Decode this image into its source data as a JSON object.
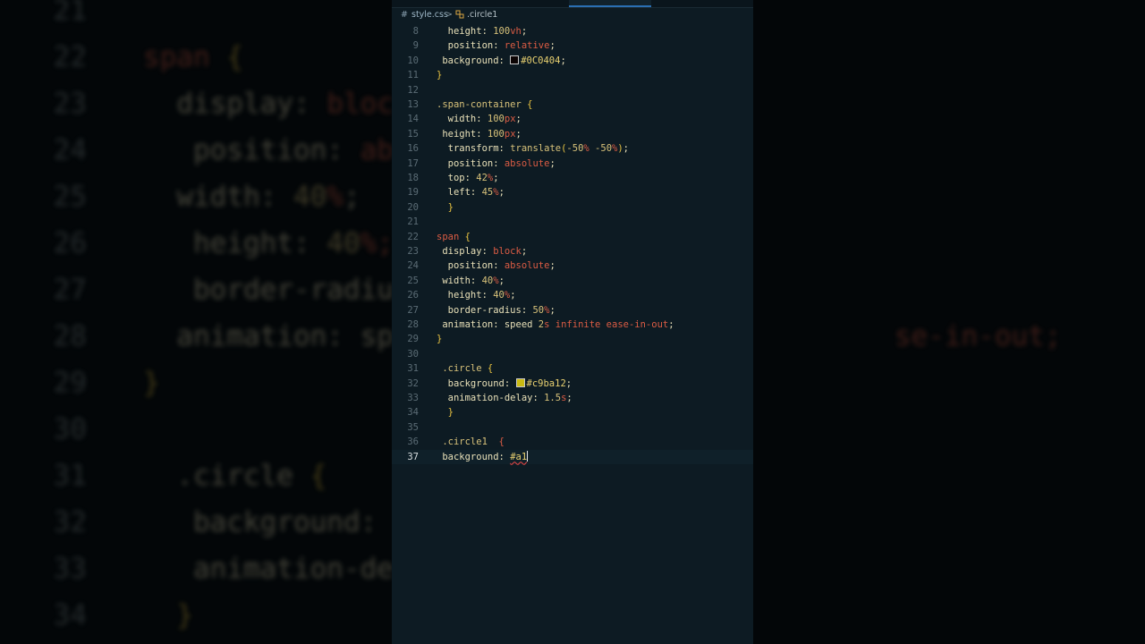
{
  "backdrop": {
    "lines": [
      {
        "num": "21",
        "segs": [
          {
            "t": "",
            "c": "w"
          }
        ]
      },
      {
        "num": "22",
        "segs": [
          {
            "t": "span",
            "c": "k"
          },
          {
            "t": " {",
            "c": "b"
          }
        ]
      },
      {
        "num": "23",
        "segs": [
          {
            "t": "  display: ",
            "c": "p"
          },
          {
            "t": "bloc",
            "c": "k"
          }
        ]
      },
      {
        "num": "24",
        "segs": [
          {
            "t": "   position: ",
            "c": "p"
          },
          {
            "t": "ab",
            "c": "k"
          }
        ]
      },
      {
        "num": "25",
        "segs": [
          {
            "t": "  width: ",
            "c": "p"
          },
          {
            "t": "40",
            "c": "n"
          },
          {
            "t": "%",
            "c": "u"
          },
          {
            "t": ";",
            "c": "p"
          }
        ]
      },
      {
        "num": "26",
        "segs": [
          {
            "t": "   height: ",
            "c": "p"
          },
          {
            "t": "40",
            "c": "n"
          },
          {
            "t": "%;",
            "c": "u"
          }
        ]
      },
      {
        "num": "27",
        "segs": [
          {
            "t": "   border-radiu",
            "c": "p"
          }
        ]
      },
      {
        "num": "28",
        "segs": [
          {
            "t": "  animation: sp",
            "c": "p"
          },
          {
            "t": "                              se-in-out;",
            "c": "k"
          }
        ]
      },
      {
        "num": "29",
        "segs": [
          {
            "t": "}",
            "c": "b"
          }
        ]
      },
      {
        "num": "30",
        "segs": [
          {
            "t": "",
            "c": "w"
          }
        ]
      },
      {
        "num": "31",
        "segs": [
          {
            "t": "  .circle ",
            "c": "p"
          },
          {
            "t": "{",
            "c": "b"
          }
        ]
      },
      {
        "num": "32",
        "segs": [
          {
            "t": "   background:",
            "c": "p"
          }
        ]
      },
      {
        "num": "33",
        "segs": [
          {
            "t": "   animation-de",
            "c": "p"
          }
        ]
      },
      {
        "num": "34",
        "segs": [
          {
            "t": "  }",
            "c": "b"
          }
        ]
      }
    ]
  },
  "breadcrumb": {
    "hash_icon": "#",
    "file": "style.css",
    "chevron": ">",
    "symbol_icon": "css-selector-icon",
    "symbol": ".circle1"
  },
  "editor": {
    "lines": [
      {
        "num": "8",
        "segs": [
          {
            "t": "  height: ",
            "c": "p"
          },
          {
            "t": "100",
            "c": "n"
          },
          {
            "t": "vh",
            "c": "u"
          },
          {
            "t": ";",
            "c": "p"
          }
        ]
      },
      {
        "num": "9",
        "segs": [
          {
            "t": "  position: ",
            "c": "p"
          },
          {
            "t": "relative",
            "c": "k"
          },
          {
            "t": ";",
            "c": "p"
          }
        ]
      },
      {
        "num": "10",
        "segs": [
          {
            "t": " background: ",
            "c": "p"
          },
          {
            "swatch": "#0C0404"
          },
          {
            "t": "#0C0404",
            "c": "s"
          },
          {
            "t": ";",
            "c": "p"
          }
        ]
      },
      {
        "num": "11",
        "segs": [
          {
            "t": "}",
            "c": "b"
          }
        ]
      },
      {
        "num": "12",
        "segs": []
      },
      {
        "num": "13",
        "segs": [
          {
            "t": ".span-container ",
            "c": "v"
          },
          {
            "t": "{",
            "c": "b"
          }
        ]
      },
      {
        "num": "14",
        "segs": [
          {
            "t": "  width: ",
            "c": "p"
          },
          {
            "t": "100",
            "c": "n"
          },
          {
            "t": "px",
            "c": "u"
          },
          {
            "t": ";",
            "c": "p"
          }
        ]
      },
      {
        "num": "15",
        "segs": [
          {
            "t": " height: ",
            "c": "p"
          },
          {
            "t": "100",
            "c": "n"
          },
          {
            "t": "px",
            "c": "u"
          },
          {
            "t": ";",
            "c": "p"
          }
        ]
      },
      {
        "num": "16",
        "segs": [
          {
            "t": "  transform: ",
            "c": "p"
          },
          {
            "t": "translate",
            "c": "v"
          },
          {
            "t": "(",
            "c": "b"
          },
          {
            "t": "-50",
            "c": "n"
          },
          {
            "t": "% ",
            "c": "u"
          },
          {
            "t": "-50",
            "c": "n"
          },
          {
            "t": "%",
            "c": "u"
          },
          {
            "t": ")",
            "c": "b"
          },
          {
            "t": ";",
            "c": "p"
          }
        ]
      },
      {
        "num": "17",
        "segs": [
          {
            "t": "  position: ",
            "c": "p"
          },
          {
            "t": "absolute",
            "c": "k"
          },
          {
            "t": ";",
            "c": "p"
          }
        ]
      },
      {
        "num": "18",
        "segs": [
          {
            "t": "  top: ",
            "c": "p"
          },
          {
            "t": "42",
            "c": "n"
          },
          {
            "t": "%",
            "c": "u"
          },
          {
            "t": ";",
            "c": "p"
          }
        ]
      },
      {
        "num": "19",
        "segs": [
          {
            "t": "  left: ",
            "c": "p"
          },
          {
            "t": "45",
            "c": "n"
          },
          {
            "t": "%",
            "c": "u"
          },
          {
            "t": ";",
            "c": "p"
          }
        ]
      },
      {
        "num": "20",
        "segs": [
          {
            "t": "  }",
            "c": "b"
          }
        ]
      },
      {
        "num": "21",
        "segs": []
      },
      {
        "num": "22",
        "segs": [
          {
            "t": "span ",
            "c": "k"
          },
          {
            "t": "{",
            "c": "b"
          }
        ]
      },
      {
        "num": "23",
        "segs": [
          {
            "t": " display: ",
            "c": "p"
          },
          {
            "t": "block",
            "c": "k"
          },
          {
            "t": ";",
            "c": "p"
          }
        ]
      },
      {
        "num": "24",
        "segs": [
          {
            "t": "  position: ",
            "c": "p"
          },
          {
            "t": "absolute",
            "c": "k"
          },
          {
            "t": ";",
            "c": "p"
          }
        ]
      },
      {
        "num": "25",
        "segs": [
          {
            "t": " width: ",
            "c": "p"
          },
          {
            "t": "40",
            "c": "n"
          },
          {
            "t": "%",
            "c": "u"
          },
          {
            "t": ";",
            "c": "p"
          }
        ]
      },
      {
        "num": "26",
        "segs": [
          {
            "t": "  height: ",
            "c": "p"
          },
          {
            "t": "40",
            "c": "n"
          },
          {
            "t": "%",
            "c": "u"
          },
          {
            "t": ";",
            "c": "p"
          }
        ]
      },
      {
        "num": "27",
        "segs": [
          {
            "t": "  border-radius: ",
            "c": "p"
          },
          {
            "t": "50",
            "c": "n"
          },
          {
            "t": "%",
            "c": "u"
          },
          {
            "t": ";",
            "c": "p"
          }
        ]
      },
      {
        "num": "28",
        "segs": [
          {
            "t": " animation: speed ",
            "c": "p"
          },
          {
            "t": "2",
            "c": "n"
          },
          {
            "t": "s ",
            "c": "u"
          },
          {
            "t": "infinite ease-in-out",
            "c": "k"
          },
          {
            "t": ";",
            "c": "p"
          }
        ]
      },
      {
        "num": "29",
        "segs": [
          {
            "t": "}",
            "c": "b"
          }
        ]
      },
      {
        "num": "30",
        "segs": []
      },
      {
        "num": "31",
        "segs": [
          {
            "t": " .circle ",
            "c": "v"
          },
          {
            "t": "{",
            "c": "b"
          }
        ]
      },
      {
        "num": "32",
        "segs": [
          {
            "t": "  background: ",
            "c": "p"
          },
          {
            "swatch": "#c9ba12"
          },
          {
            "t": "#c9ba12",
            "c": "s"
          },
          {
            "t": ";",
            "c": "p"
          }
        ]
      },
      {
        "num": "33",
        "segs": [
          {
            "t": "  animation-delay: ",
            "c": "p"
          },
          {
            "t": "1.5",
            "c": "n"
          },
          {
            "t": "s",
            "c": "u"
          },
          {
            "t": ";",
            "c": "p"
          }
        ]
      },
      {
        "num": "34",
        "segs": [
          {
            "t": "  }",
            "c": "b"
          }
        ]
      },
      {
        "num": "35",
        "segs": []
      },
      {
        "num": "36",
        "segs": [
          {
            "t": " .circle1  ",
            "c": "v"
          },
          {
            "t": "{",
            "c": "u"
          }
        ]
      },
      {
        "num": "37",
        "current": true,
        "segs": [
          {
            "t": " background: ",
            "c": "p"
          },
          {
            "t": "#a1",
            "c": "s",
            "squiggle": true
          },
          {
            "caret": true
          }
        ]
      }
    ]
  },
  "colors": {
    "editor_bg": "#0d1b23",
    "keyword": "#dc5c44",
    "selector": "#d8c27a",
    "brace": "#e8c341"
  }
}
